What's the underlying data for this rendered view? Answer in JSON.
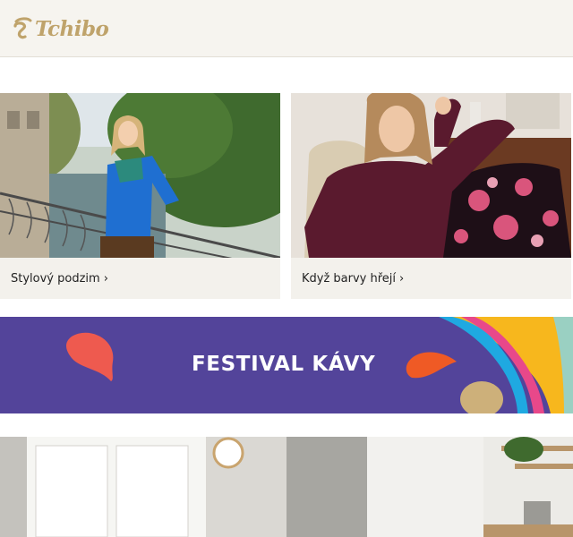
{
  "brand": {
    "name": "Tchibo",
    "color": "#bfa36b"
  },
  "tiles": [
    {
      "caption": "Stylový podzim",
      "chevron": "›"
    },
    {
      "caption": "Když barvy hřejí",
      "chevron": "›"
    }
  ],
  "banner": {
    "title": "FESTIVAL KÁVY",
    "background": "#53449a"
  },
  "colors": {
    "header_bg": "#f6f4ef",
    "tile_bg": "#f3f1ec",
    "accent_purple": "#53449a"
  }
}
